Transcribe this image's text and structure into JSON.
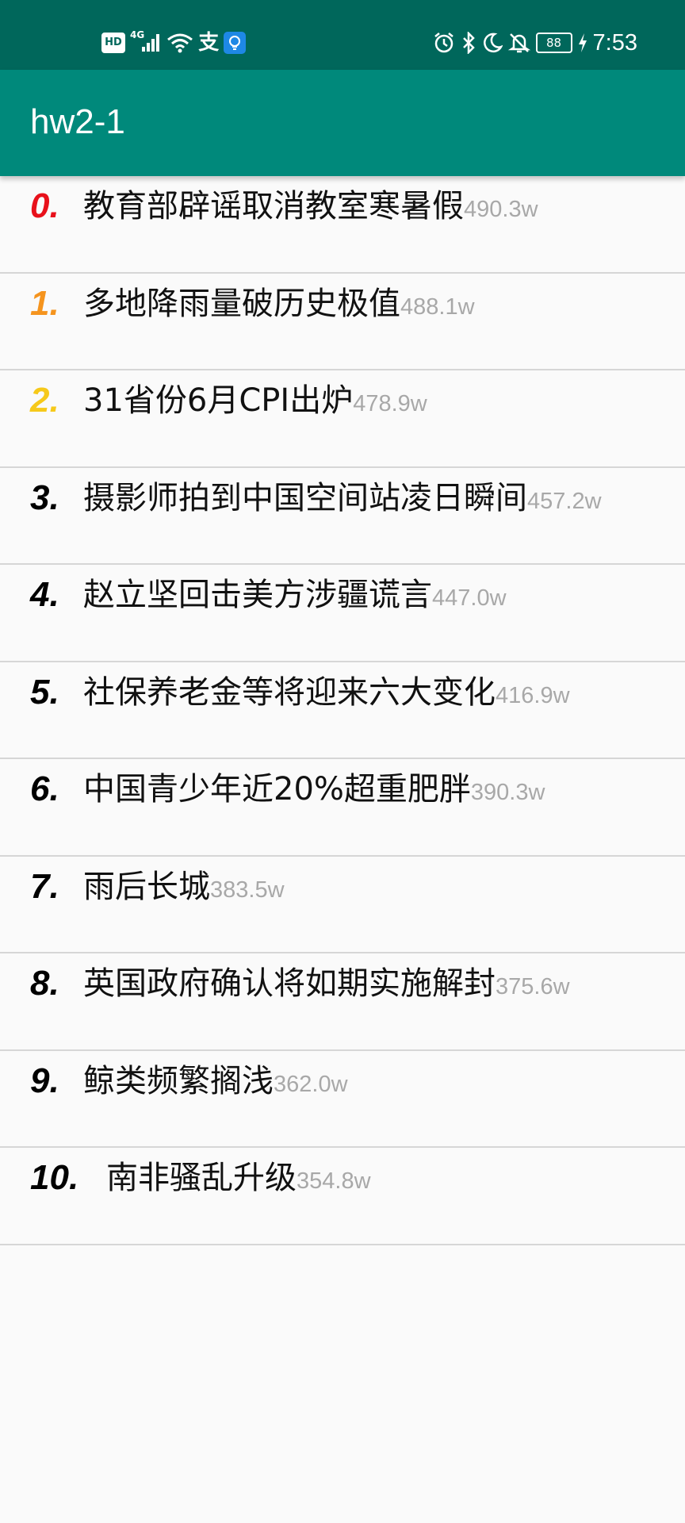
{
  "status_bar": {
    "left_icons": [
      "hd-icon",
      "4g-signal-icon",
      "wifi-icon",
      "alipay-icon",
      "lightbulb-app-icon"
    ],
    "hd_label": "HD",
    "network_label": "4G",
    "pay_glyph": "支",
    "right_icons": [
      "alarm-icon",
      "bluetooth-icon",
      "moon-icon",
      "mute-bell-icon",
      "battery-icon",
      "charging-icon"
    ],
    "battery": "88",
    "time": "7:53"
  },
  "app_bar": {
    "title": "hw2-1",
    "color": "#00897b",
    "status_color": "#00675b"
  },
  "hot_list": [
    {
      "rank": "0.",
      "title": "教育部辟谣取消教室寒暑假",
      "heat": "490.3w",
      "rank_color": "#e8111b"
    },
    {
      "rank": "1.",
      "title": "多地降雨量破历史极值",
      "heat": "488.1w",
      "rank_color": "#f5941e"
    },
    {
      "rank": "2.",
      "title": "31省份6月CPI出炉",
      "heat": "478.9w",
      "rank_color": "#f6c91a"
    },
    {
      "rank": "3.",
      "title": "摄影师拍到中国空间站凌日瞬间",
      "heat": "457.2w",
      "rank_color": "#000000"
    },
    {
      "rank": "4.",
      "title": "赵立坚回击美方涉疆谎言",
      "heat": "447.0w",
      "rank_color": "#000000"
    },
    {
      "rank": "5.",
      "title": "社保养老金等将迎来六大变化",
      "heat": "416.9w",
      "rank_color": "#000000"
    },
    {
      "rank": "6.",
      "title": "中国青少年近20%超重肥胖",
      "heat": "390.3w",
      "rank_color": "#000000"
    },
    {
      "rank": "7.",
      "title": "雨后长城",
      "heat": "383.5w",
      "rank_color": "#000000"
    },
    {
      "rank": "8.",
      "title": "英国政府确认将如期实施解封",
      "heat": "375.6w",
      "rank_color": "#000000"
    },
    {
      "rank": "9.",
      "title": "鲸类频繁搁浅",
      "heat": "362.0w",
      "rank_color": "#000000"
    },
    {
      "rank": "10.",
      "title": "南非骚乱升级",
      "heat": "354.8w",
      "rank_color": "#000000"
    }
  ]
}
